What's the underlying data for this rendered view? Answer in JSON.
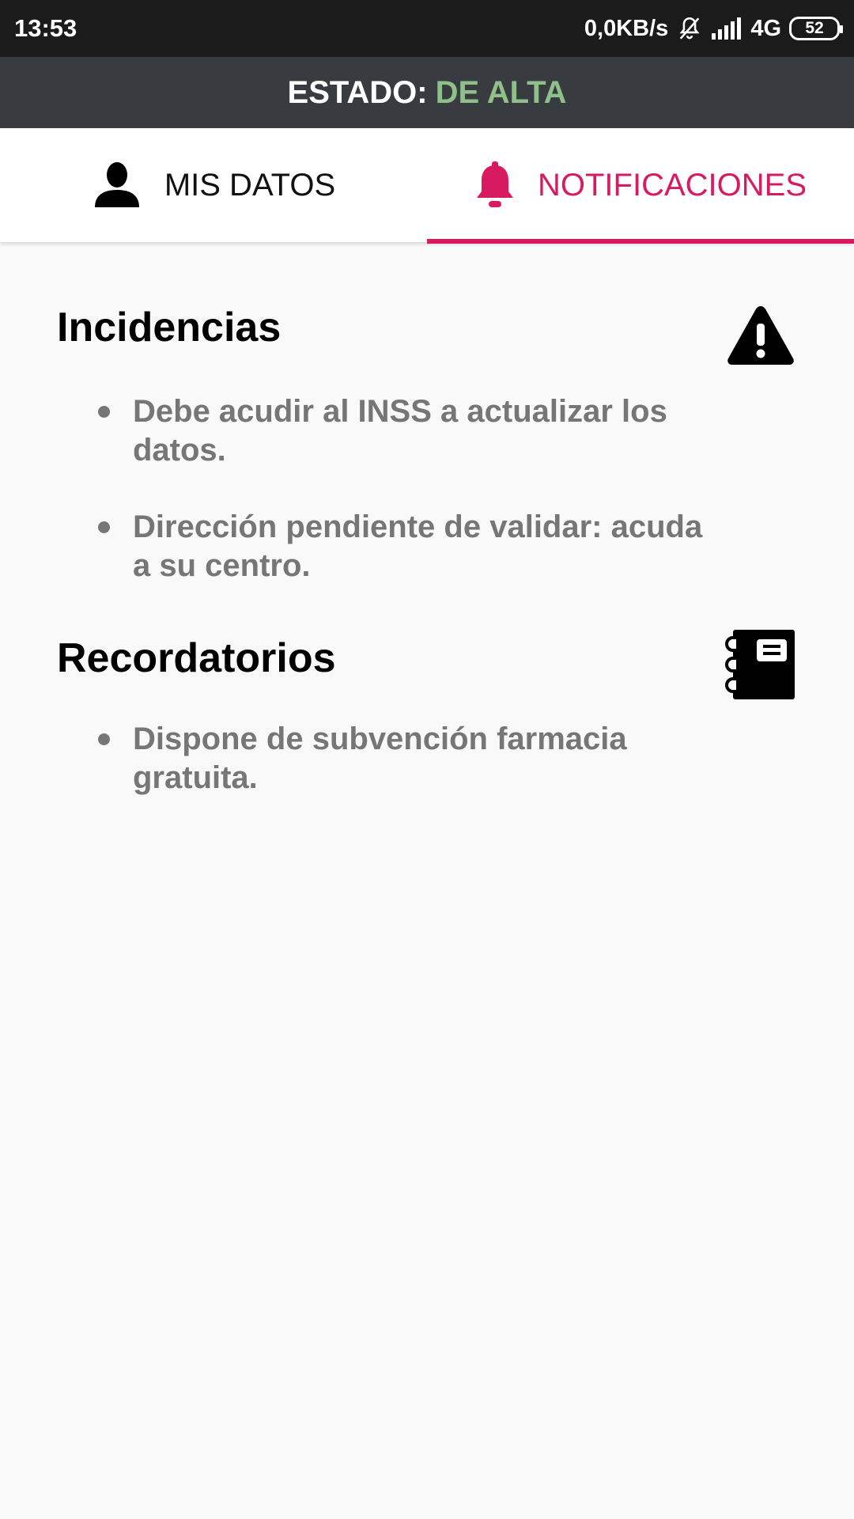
{
  "status_bar": {
    "time": "13:53",
    "network_speed": "0,0KB/s",
    "network_type": "4G",
    "battery_level": "52",
    "icons": [
      "notifications-off-icon",
      "signal-icon",
      "battery-icon"
    ]
  },
  "estado": {
    "label": "ESTADO:",
    "value": "DE ALTA",
    "value_color": "#8fc08a"
  },
  "tabs": [
    {
      "label": "MIS DATOS",
      "icon": "person-icon",
      "selected": false
    },
    {
      "label": "NOTIFICACIONES",
      "icon": "bell-icon",
      "selected": true
    }
  ],
  "accent_color": "#d81b60",
  "sections": {
    "incidencias": {
      "title": "Incidencias",
      "icon": "warning-icon",
      "items": [
        "Debe acudir al INSS a actualizar los datos.",
        "Dirección pendiente de validar: acuda a su centro."
      ]
    },
    "recordatorios": {
      "title": "Recordatorios",
      "icon": "notebook-icon",
      "items": [
        "Dispone de subvención farmacia gratuita."
      ]
    }
  }
}
